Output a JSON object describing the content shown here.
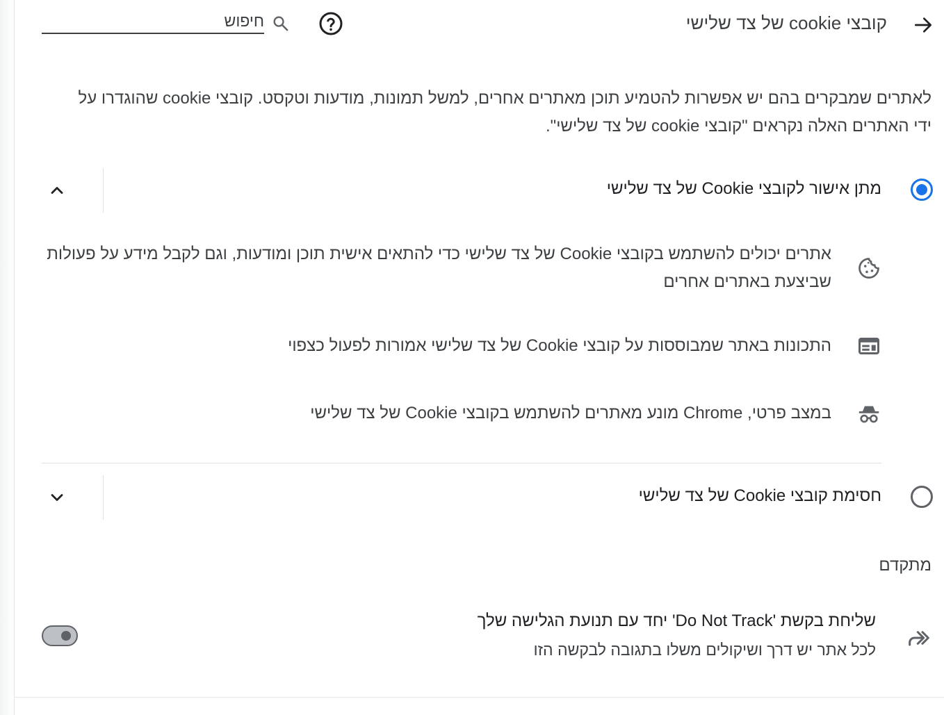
{
  "header": {
    "title": "קובצי cookie של צד שלישי",
    "search_placeholder": "חיפוש"
  },
  "description": "לאתרים שמבקרים בהם יש אפשרות להטמיע תוכן מאתרים אחרים, למשל תמונות, מודעות וטקסט. קובצי cookie שהוגדרו על ידי האתרים האלה נקראים \"קובצי cookie של צד שלישי\".",
  "options": [
    {
      "label": "מתן אישור לקובצי Cookie של צד שלישי",
      "selected": true,
      "expanded": true,
      "details": [
        {
          "icon": "cookie-icon",
          "text": "אתרים יכולים להשתמש בקובצי Cookie של צד שלישי כדי להתאים אישית תוכן ומודעות, וגם לקבל מידע על פעולות שביצעת באתרים אחרים"
        },
        {
          "icon": "web-asset-icon",
          "text": "התכונות באתר שמבוססות על קובצי Cookie של צד שלישי אמורות לפעול כצפוי"
        },
        {
          "icon": "incognito-icon",
          "text": "במצב פרטי, Chrome מונע מאתרים להשתמש בקובצי Cookie של צד שלישי"
        }
      ]
    },
    {
      "label": "חסימת קובצי Cookie של צד שלישי",
      "selected": false,
      "expanded": false
    }
  ],
  "advanced": {
    "heading": "מתקדם",
    "do_not_track": {
      "icon": "do-not-track-icon",
      "title": "שליחת בקשת 'Do Not Track' יחד עם תנועת הגלישה שלך",
      "subtitle": "לכל אתר יש דרך ושיקולים משלו בתגובה לבקשה הזו",
      "enabled": false
    }
  },
  "colors": {
    "accent": "#1a73e8",
    "text_primary": "#202124",
    "text_secondary": "#3c4043",
    "icon": "#5f6368"
  }
}
